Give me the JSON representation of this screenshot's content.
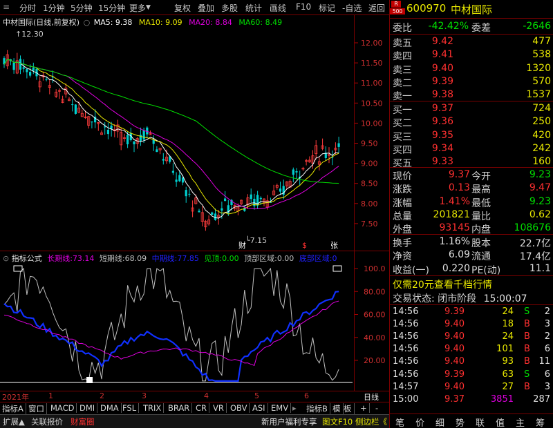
{
  "toolbar": {
    "left_items": [
      "分时",
      "1分钟",
      "5分钟",
      "15分钟",
      "更多"
    ],
    "right_items": [
      "复权",
      "叠加",
      "多股",
      "统计",
      "画线",
      "F10",
      "标记",
      "-自选",
      "返回"
    ]
  },
  "main_chart": {
    "title": "中材国际(日线,前复权)",
    "ma5": "MA5: 9.38",
    "ma10": "MA10: 9.09",
    "ma20": "MA20: 8.84",
    "ma60": "MA60: 8.49",
    "high_label": "12.30",
    "low_label": "7.15",
    "marks": [
      "财",
      "$",
      "张"
    ],
    "price_ticks": [
      "12.00",
      "11.50",
      "11.00",
      "10.50",
      "10.00",
      "9.50",
      "9.00",
      "8.50",
      "8.00",
      "7.50"
    ]
  },
  "indicator": {
    "name": "指标公式",
    "long_label": "长期线:",
    "long_val": "73.14",
    "short_label": "短期线:",
    "short_val": "68.09",
    "mid_label": "中期线:",
    "mid_val": "77.85",
    "top_label": "见顶:",
    "top_val": "0.00",
    "topzone_label": "顶部区域:",
    "topzone_val": "0.00",
    "bottom_label": "底部区域:",
    "bottom_val": "0",
    "ticks": [
      "100.0",
      "80.00",
      "60.00",
      "40.00",
      "20.00"
    ]
  },
  "date_axis": {
    "year": "2021年",
    "months": [
      "1",
      "2",
      "3",
      "4",
      "5",
      "6"
    ],
    "right_label": "日线"
  },
  "indicator_tabs": [
    "指标A",
    "窗口",
    "MACD",
    "DMI",
    "DMA",
    "FSL",
    "TRIX",
    "BRAR",
    "CR",
    "VR",
    "OBV",
    "ASI",
    "EMV",
    "指标B",
    "模",
    "板",
    "+",
    "-"
  ],
  "bottom_bar": {
    "items": [
      "扩展▲",
      "关联报价",
      "财富圈"
    ],
    "right_items": [
      "新用户福利专享",
      "图文F10",
      "侧边栏《"
    ]
  },
  "quote": {
    "code": "600970",
    "name": "中材国际",
    "r_badge": "R",
    "num_badge": "500",
    "weibi_label": "委比",
    "weibi": "-42.42%",
    "weicha_label": "委差",
    "weicha": "-2646",
    "asks": [
      {
        "label": "卖五",
        "price": "9.42",
        "vol": "477"
      },
      {
        "label": "卖四",
        "price": "9.41",
        "vol": "538"
      },
      {
        "label": "卖三",
        "price": "9.40",
        "vol": "1320"
      },
      {
        "label": "卖二",
        "price": "9.39",
        "vol": "570"
      },
      {
        "label": "卖一",
        "price": "9.38",
        "vol": "1537"
      }
    ],
    "bids": [
      {
        "label": "买一",
        "price": "9.37",
        "vol": "724"
      },
      {
        "label": "买二",
        "price": "9.36",
        "vol": "250"
      },
      {
        "label": "买三",
        "price": "9.35",
        "vol": "420"
      },
      {
        "label": "买四",
        "price": "9.34",
        "vol": "242"
      },
      {
        "label": "买五",
        "price": "9.33",
        "vol": "160"
      }
    ],
    "stats": [
      {
        "l1": "现价",
        "v1": "9.37",
        "l2": "今开",
        "v2": "9.23"
      },
      {
        "l1": "涨跌",
        "v1": "0.13",
        "l2": "最高",
        "v2": "9.47"
      },
      {
        "l1": "涨幅",
        "v1": "1.41%",
        "l2": "最低",
        "v2": "9.23"
      },
      {
        "l1": "总量",
        "v1": "201821",
        "l2": "量比",
        "v2": "0.62"
      },
      {
        "l1": "外盘",
        "v1": "93145",
        "l2": "内盘",
        "v2": "108676"
      }
    ],
    "stats2": [
      {
        "l1": "换手",
        "v1": "1.16%",
        "l2": "股本",
        "v2": "22.7亿"
      },
      {
        "l1": "净资",
        "v1": "6.09",
        "l2": "流通",
        "v2": "17.4亿"
      },
      {
        "l1": "收益(一)",
        "v1": "0.220",
        "l2": "PE(动)",
        "v2": "11.1"
      }
    ],
    "promo": "仅需20元查看千档行情",
    "status_label": "交易状态:",
    "status_val": "闭市阶段",
    "status_time": "15:00:07",
    "ticks": [
      {
        "t": "14:56",
        "p": "9.39",
        "v": "24",
        "d": "S",
        "n": "2"
      },
      {
        "t": "14:56",
        "p": "9.40",
        "v": "18",
        "d": "B",
        "n": "3"
      },
      {
        "t": "14:56",
        "p": "9.40",
        "v": "24",
        "d": "B",
        "n": "2"
      },
      {
        "t": "14:56",
        "p": "9.40",
        "v": "101",
        "d": "B",
        "n": "6"
      },
      {
        "t": "14:56",
        "p": "9.40",
        "v": "93",
        "d": "B",
        "n": "11"
      },
      {
        "t": "14:56",
        "p": "9.39",
        "v": "63",
        "d": "S",
        "n": "6"
      },
      {
        "t": "14:57",
        "p": "9.40",
        "v": "27",
        "d": "B",
        "n": "3"
      },
      {
        "t": "15:00",
        "p": "9.37",
        "v": "3851",
        "d": "",
        "n": "287"
      }
    ],
    "tabs": [
      "笔",
      "价",
      "细",
      "势",
      "联",
      "值",
      "主",
      "筹"
    ]
  }
}
